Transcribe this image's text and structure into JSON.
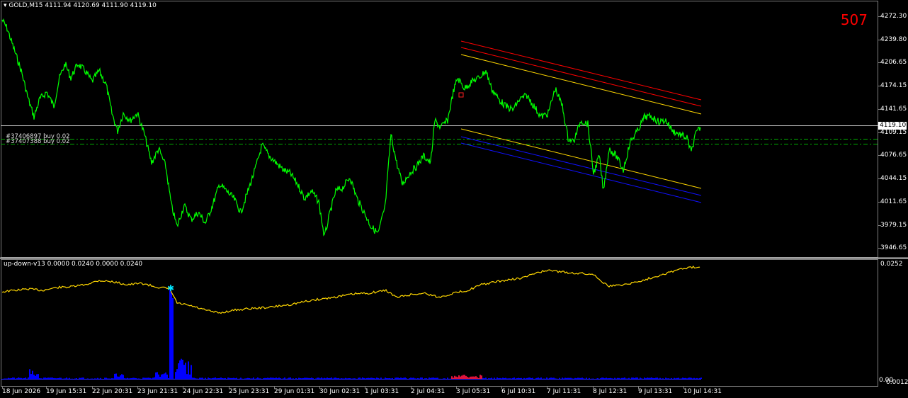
{
  "header": {
    "symbol": "GOLD,M15",
    "ohlc": "4111.94 4120.69 4111.90 4119.10"
  },
  "counter": "507",
  "current_price": "4119.10",
  "orders": [
    {
      "label": "#37406897 buy 0.02"
    },
    {
      "label": "#37407388 buy 0.02"
    }
  ],
  "price_axis": [
    "4272.30",
    "4239.80",
    "4206.65",
    "4174.15",
    "4141.65",
    "4109.15",
    "4076.65",
    "4044.15",
    "4011.65",
    "3979.15",
    "3946.65"
  ],
  "indicator": {
    "name": "up-down-v13 0.0000 0.0240 0.0000 0.0240",
    "axis_top": "0.0252",
    "axis_bottom": "0.00",
    "axis_bottom2": "0.0012"
  },
  "time_axis": [
    "18 Jun 2026",
    "19 Jun 15:31",
    "22 Jun 20:31",
    "23 Jun 21:31",
    "24 Jun 22:31",
    "25 Jun 23:31",
    "29 Jun 01:31",
    "30 Jun 02:31",
    "1 Jul 03:31",
    "2 Jul 04:31",
    "3 Jul 05:31",
    "6 Jul 10:31",
    "7 Jul 11:31",
    "8 Jul 12:31",
    "9 Jul 13:31",
    "10 Jul 14:31"
  ],
  "colors": {
    "price_line": "#00ff00",
    "indicator_line": "#ffd700",
    "histogram_up": "#0000ff",
    "histogram_down": "#dc143c",
    "channel_upper": "#ff0000",
    "channel_mid": "#ffd700",
    "channel_lower": "#0000ff",
    "order_line": "#00cc00"
  }
}
